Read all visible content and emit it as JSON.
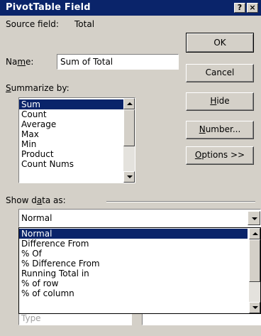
{
  "window": {
    "title": "PivotTable Field",
    "help_glyph": "?",
    "close_glyph": "×"
  },
  "source_field": {
    "label": "Source field:",
    "value": "Total"
  },
  "name_field": {
    "label_pre": "Na",
    "label_u": "m",
    "label_post": "e:",
    "value": "Sum of Total"
  },
  "summarize": {
    "label_u": "S",
    "label_rest": "ummarize by:",
    "items": [
      "Sum",
      "Count",
      "Average",
      "Max",
      "Min",
      "Product",
      "Count Nums"
    ],
    "selected_index": 0
  },
  "buttons": {
    "ok": "OK",
    "cancel": "Cancel",
    "hide_u": "H",
    "hide_rest": "ide",
    "number_u": "N",
    "number_rest": "umber...",
    "options_u": "O",
    "options_rest": "ptions >>"
  },
  "show_data_as": {
    "label_pre": "Show d",
    "label_u": "a",
    "label_post": "ta as:",
    "value": "Normal",
    "options": [
      "Normal",
      "Difference From",
      "% Of",
      "% Difference From",
      "Running Total in",
      "% of row",
      "% of column"
    ],
    "selected_index": 0
  },
  "hidden_row": {
    "label": "Type"
  },
  "colors": {
    "title_bg": "#0a246a",
    "face": "#d4d0c8",
    "selection": "#0a246a"
  }
}
